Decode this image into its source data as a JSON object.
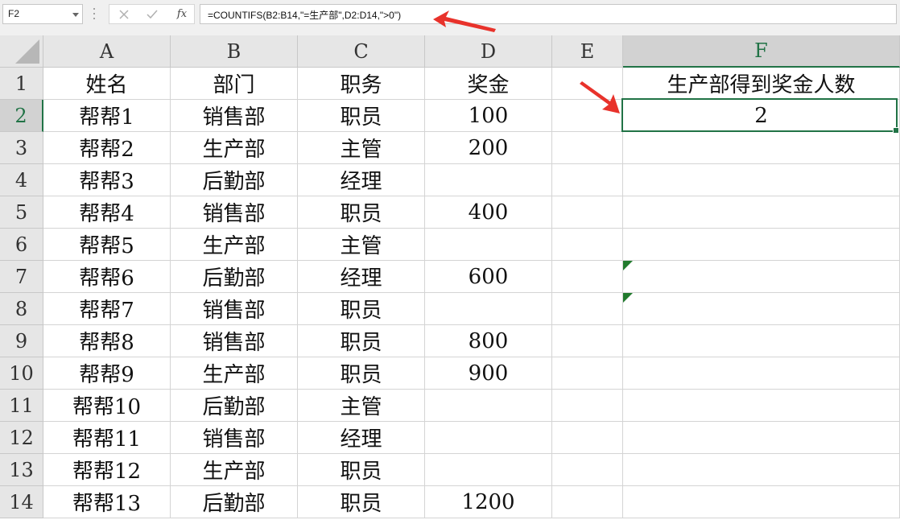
{
  "formula_bar": {
    "name_box": "F2",
    "formula": "=COUNTIFS(B2:B14,\"=生产部\",D2:D14,\">0\")",
    "fx_label": "fx"
  },
  "columns": [
    "A",
    "B",
    "C",
    "D",
    "E",
    "F"
  ],
  "selected_column": "F",
  "selected_row": "2",
  "rows": [
    {
      "num": "1",
      "cells": [
        "姓名",
        "部门",
        "职务",
        "奖金",
        "",
        "生产部得到奖金人数"
      ]
    },
    {
      "num": "2",
      "cells": [
        "帮帮1",
        "销售部",
        "职员",
        "100",
        "",
        "2"
      ]
    },
    {
      "num": "3",
      "cells": [
        "帮帮2",
        "生产部",
        "主管",
        "200",
        "",
        ""
      ]
    },
    {
      "num": "4",
      "cells": [
        "帮帮3",
        "后勤部",
        "经理",
        "",
        "",
        ""
      ]
    },
    {
      "num": "5",
      "cells": [
        "帮帮4",
        "销售部",
        "职员",
        "400",
        "",
        ""
      ]
    },
    {
      "num": "6",
      "cells": [
        "帮帮5",
        "生产部",
        "主管",
        "",
        "",
        ""
      ]
    },
    {
      "num": "7",
      "cells": [
        "帮帮6",
        "后勤部",
        "经理",
        "600",
        "",
        ""
      ]
    },
    {
      "num": "8",
      "cells": [
        "帮帮7",
        "销售部",
        "职员",
        "",
        "",
        ""
      ]
    },
    {
      "num": "9",
      "cells": [
        "帮帮8",
        "销售部",
        "职员",
        "800",
        "",
        ""
      ]
    },
    {
      "num": "10",
      "cells": [
        "帮帮9",
        "生产部",
        "职员",
        "900",
        "",
        ""
      ]
    },
    {
      "num": "11",
      "cells": [
        "帮帮10",
        "后勤部",
        "主管",
        "",
        "",
        ""
      ]
    },
    {
      "num": "12",
      "cells": [
        "帮帮11",
        "销售部",
        "经理",
        "",
        "",
        ""
      ]
    },
    {
      "num": "13",
      "cells": [
        "帮帮12",
        "生产部",
        "职员",
        "",
        "",
        ""
      ]
    },
    {
      "num": "14",
      "cells": [
        "帮帮13",
        "后勤部",
        "职员",
        "1200",
        "",
        ""
      ]
    }
  ],
  "colors": {
    "selection": "#217346",
    "annotation_arrow": "#e8322b",
    "error_flag": "#217a2d"
  },
  "icons": {
    "cancel": "x-icon",
    "enter": "check-icon",
    "function": "fx-icon",
    "annotations": "red-arrow-icon"
  }
}
